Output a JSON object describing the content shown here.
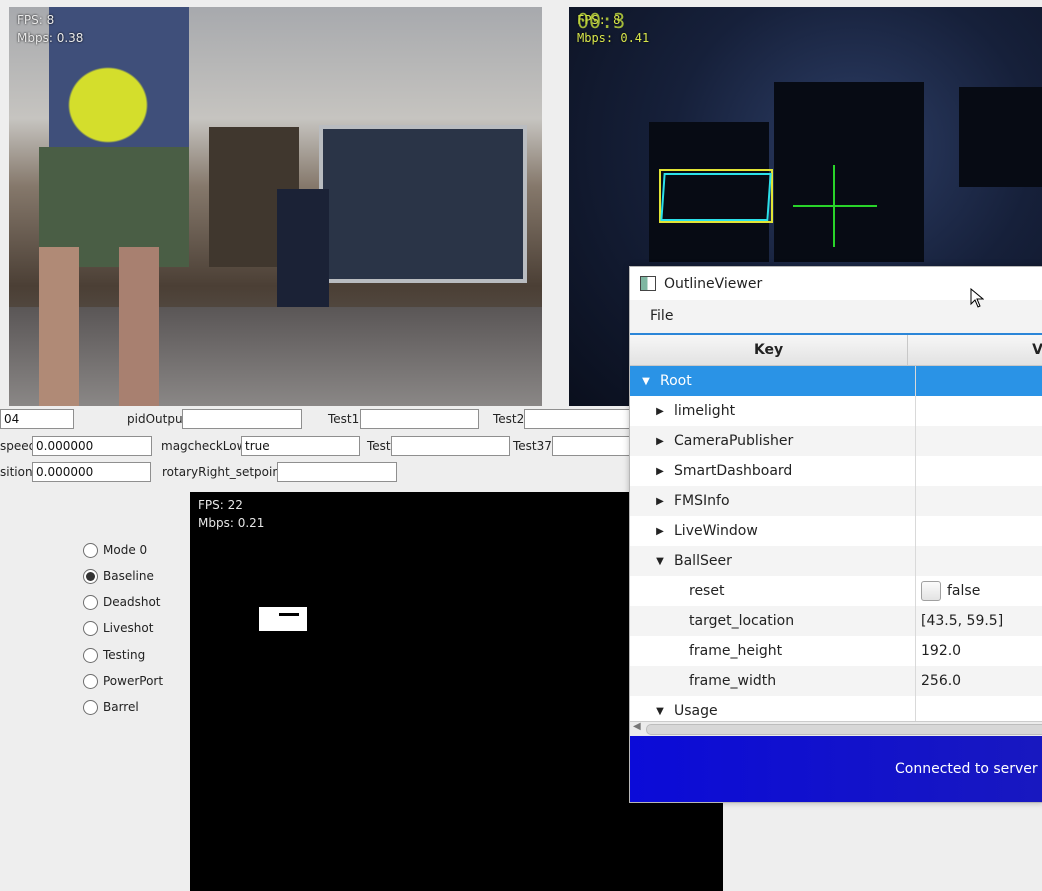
{
  "cameras": [
    {
      "fps": "FPS: 8",
      "mbps": "Mbps: 0.38"
    },
    {
      "fps": "FPS: 8",
      "mbps": "Mbps: 0.41",
      "overlay": "00:3"
    },
    {
      "fps": "FPS: 22",
      "mbps": "Mbps: 0.21"
    }
  ],
  "fields": {
    "row1": {
      "f0_value": "04",
      "pidOutput_label": "pidOutput",
      "pidOutput_value": "",
      "test1_label": "Test1",
      "test1_value": "",
      "test2_label": "Test2",
      "test2_value": ""
    },
    "row2": {
      "speed_label": "speed",
      "speed_value": "0.000000",
      "magcheck_label": "magcheckLow",
      "magcheck_value": "true",
      "test_label": "Test",
      "test_value": "",
      "test37_label": "Test37",
      "test37_value": ""
    },
    "row3": {
      "position_label": "sition",
      "position_value": "0.000000",
      "rotary_label": "rotaryRight_setpoint",
      "rotary_value": ""
    }
  },
  "modes": {
    "selected": "Baseline",
    "options": [
      "Mode 0",
      "Baseline",
      "Deadshot",
      "Liveshot",
      "Testing",
      "PowerPort",
      "Barrel"
    ]
  },
  "outline_viewer": {
    "title": "OutlineViewer",
    "menu": [
      "File"
    ],
    "columns": {
      "key": "Key",
      "value": "V"
    },
    "rows": [
      {
        "key": "Root",
        "value": "",
        "expanded": true
      },
      {
        "key": "limelight",
        "value": ""
      },
      {
        "key": "CameraPublisher",
        "value": ""
      },
      {
        "key": "SmartDashboard",
        "value": ""
      },
      {
        "key": "FMSInfo",
        "value": ""
      },
      {
        "key": "LiveWindow",
        "value": ""
      },
      {
        "key": "BallSeer",
        "value": "",
        "expanded": true
      },
      {
        "key": "reset",
        "value": "false",
        "checkbox": true
      },
      {
        "key": "target_location",
        "value": "[43.5, 59.5]"
      },
      {
        "key": "frame_height",
        "value": "192.0"
      },
      {
        "key": "frame_width",
        "value": "256.0"
      },
      {
        "key": "Usage",
        "value": "",
        "expanded": true
      }
    ],
    "status": "Connected to server at"
  },
  "icons": {
    "expand": "triangle-right-icon",
    "collapse": "triangle-down-icon",
    "app": "outline-viewer-app-icon",
    "cursor": "mouse-pointer-icon"
  }
}
